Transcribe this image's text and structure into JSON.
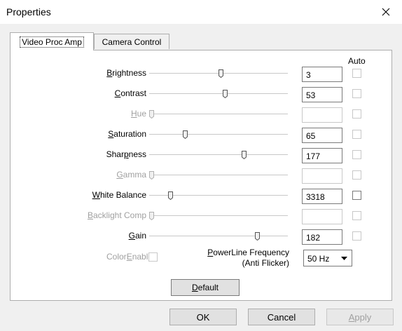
{
  "window": {
    "title": "Properties"
  },
  "tabs": [
    {
      "label": "Video Proc Amp",
      "active": true
    },
    {
      "label": "Camera Control",
      "active": false
    }
  ],
  "auto_header": "Auto",
  "controls": [
    {
      "label": "Brightness",
      "mnemonic": "B",
      "value": "3",
      "slider_fraction": 0.52,
      "enabled": true,
      "auto": false
    },
    {
      "label": "Contrast",
      "mnemonic": "C",
      "value": "53",
      "slider_fraction": 0.55,
      "enabled": true,
      "auto": false
    },
    {
      "label": "Hue",
      "mnemonic": "H",
      "value": "",
      "slider_fraction": 0.0,
      "enabled": false,
      "auto": false
    },
    {
      "label": "Saturation",
      "mnemonic": "S",
      "value": "65",
      "slider_fraction": 0.25,
      "enabled": true,
      "auto": false
    },
    {
      "label": "Sharpness",
      "mnemonic": "p",
      "value": "177",
      "slider_fraction": 0.69,
      "enabled": true,
      "auto": false
    },
    {
      "label": "Gamma",
      "mnemonic": "G",
      "value": "",
      "slider_fraction": 0.0,
      "enabled": false,
      "auto": false
    },
    {
      "label": "White Balance",
      "mnemonic": "W",
      "value": "3318",
      "slider_fraction": 0.14,
      "enabled": true,
      "auto": false
    },
    {
      "label": "Backlight Comp",
      "mnemonic": "B",
      "value": "",
      "slider_fraction": 0.0,
      "enabled": false,
      "auto": false
    },
    {
      "label": "Gain",
      "mnemonic": "G",
      "value": "182",
      "slider_fraction": 0.79,
      "enabled": true,
      "auto": false
    }
  ],
  "color_enable": {
    "label": "ColorEnable",
    "mnemonic": "E",
    "enabled": false,
    "checked": false
  },
  "powerline": {
    "label_line1": "PowerLine Frequency",
    "label_line2": "(Anti Flicker)",
    "mnemonic": "P",
    "selected": "50 Hz"
  },
  "default_button": "Default",
  "buttons": {
    "ok": "OK",
    "cancel": "Cancel",
    "apply": "Apply"
  },
  "icons": {
    "close": "close-icon",
    "dropdown": "chevron-down-icon"
  }
}
